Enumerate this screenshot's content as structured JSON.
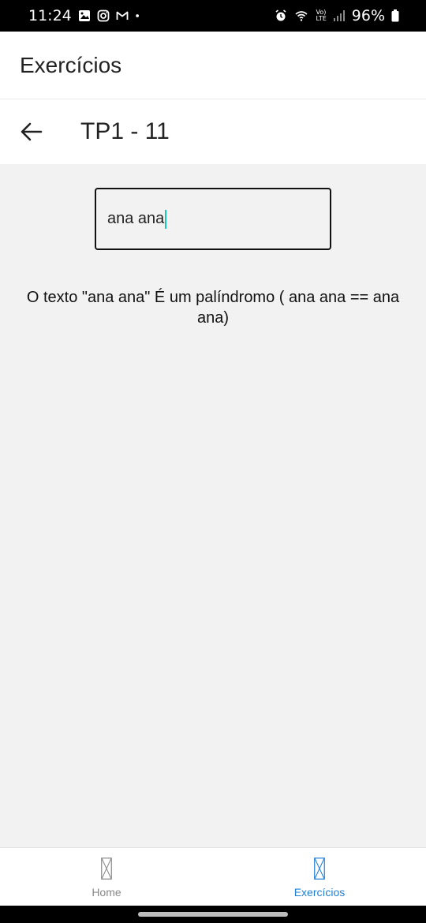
{
  "status_bar": {
    "time": "11:24",
    "battery": "96%",
    "left_icons": [
      "gallery-icon",
      "instagram-icon",
      "gmail-icon",
      "dot-icon"
    ],
    "right_icons": [
      "alarm-icon",
      "wifi-icon",
      "volte-icon",
      "signal-icon",
      "battery-icon"
    ],
    "volte_label_top": "Vo)",
    "volte_label_bottom": "LTE"
  },
  "header": {
    "title": "Exercícios"
  },
  "screen": {
    "title": "TP1 - 11",
    "back_icon": "arrow-left-icon"
  },
  "input": {
    "value": "ana ana"
  },
  "result": {
    "text": "O texto \"ana ana\" É um palíndromo ( ana ana == ana ana)"
  },
  "bottom_nav": {
    "items": [
      {
        "label": "Home",
        "icon": "placeholder-icon",
        "color": "#888888"
      },
      {
        "label": "Exercícios",
        "icon": "placeholder-icon",
        "color": "#1f7fd6",
        "active": true
      }
    ]
  },
  "colors": {
    "accent": "#1f7fd6",
    "caret": "#16c9b4"
  }
}
